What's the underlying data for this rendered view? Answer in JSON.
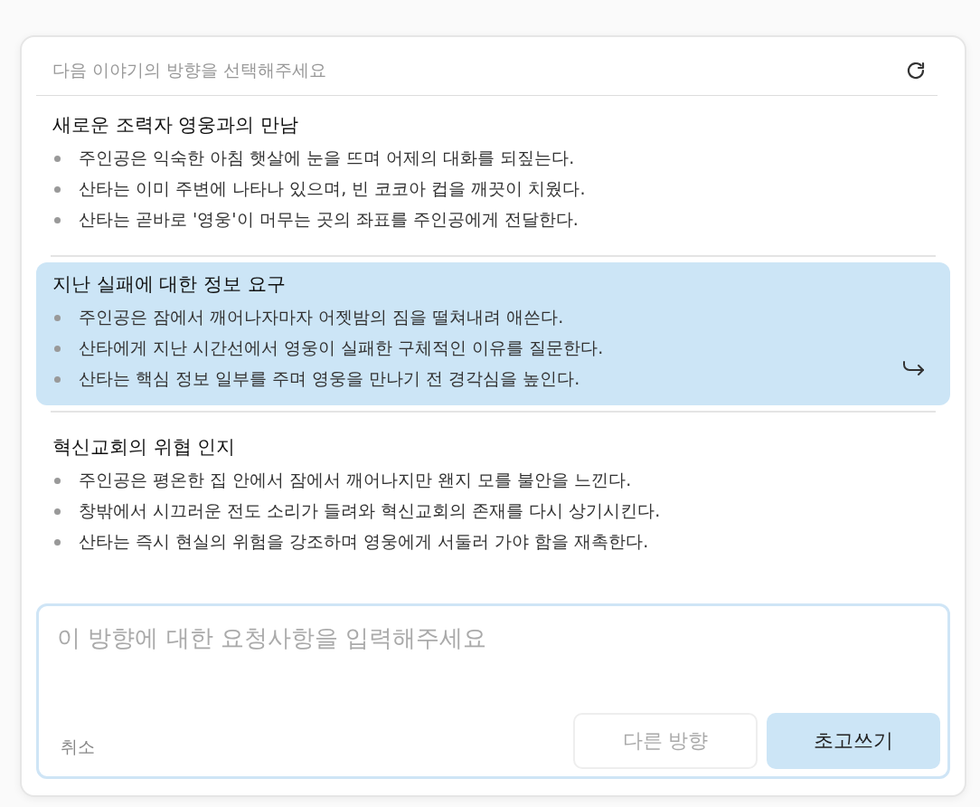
{
  "header": {
    "title": "다음 이야기의 방향을 선택해주세요"
  },
  "options": [
    {
      "title": "새로운 조력자 영웅과의 만남",
      "selected": false,
      "bullets": [
        "주인공은 익숙한 아침 햇살에 눈을 뜨며 어제의 대화를 되짚는다.",
        "산타는 이미 주변에 나타나 있으며, 빈 코코아 컵을 깨끗이 치웠다.",
        "산타는 곧바로 '영웅'이 머무는 곳의 좌표를 주인공에게 전달한다."
      ]
    },
    {
      "title": "지난 실패에 대한 정보 요구",
      "selected": true,
      "bullets": [
        "주인공은 잠에서 깨어나자마자 어젯밤의 짐을 떨쳐내려 애쓴다.",
        "산타에게 지난 시간선에서 영웅이 실패한 구체적인 이유를 질문한다.",
        "산타는 핵심 정보 일부를 주며 영웅을 만나기 전 경각심을 높인다."
      ]
    },
    {
      "title": "혁신교회의 위협 인지",
      "selected": false,
      "bullets": [
        "주인공은 평온한 집 안에서 잠에서 깨어나지만 왠지 모를 불안을 느낀다.",
        "창밖에서 시끄러운 전도 소리가 들려와 혁신교회의 존재를 다시 상기시킨다.",
        "산타는 즉시 현실의 위험을 강조하며 영웅에게 서둘러 가야 함을 재촉한다."
      ]
    }
  ],
  "request": {
    "placeholder": "이 방향에 대한 요청사항을 입력해주세요",
    "cancel": "취소",
    "buttons": [
      {
        "label": "다른 방향",
        "disabled": true,
        "kind": "secondary"
      },
      {
        "label": "초고쓰기",
        "disabled": false,
        "kind": "primary"
      }
    ]
  }
}
